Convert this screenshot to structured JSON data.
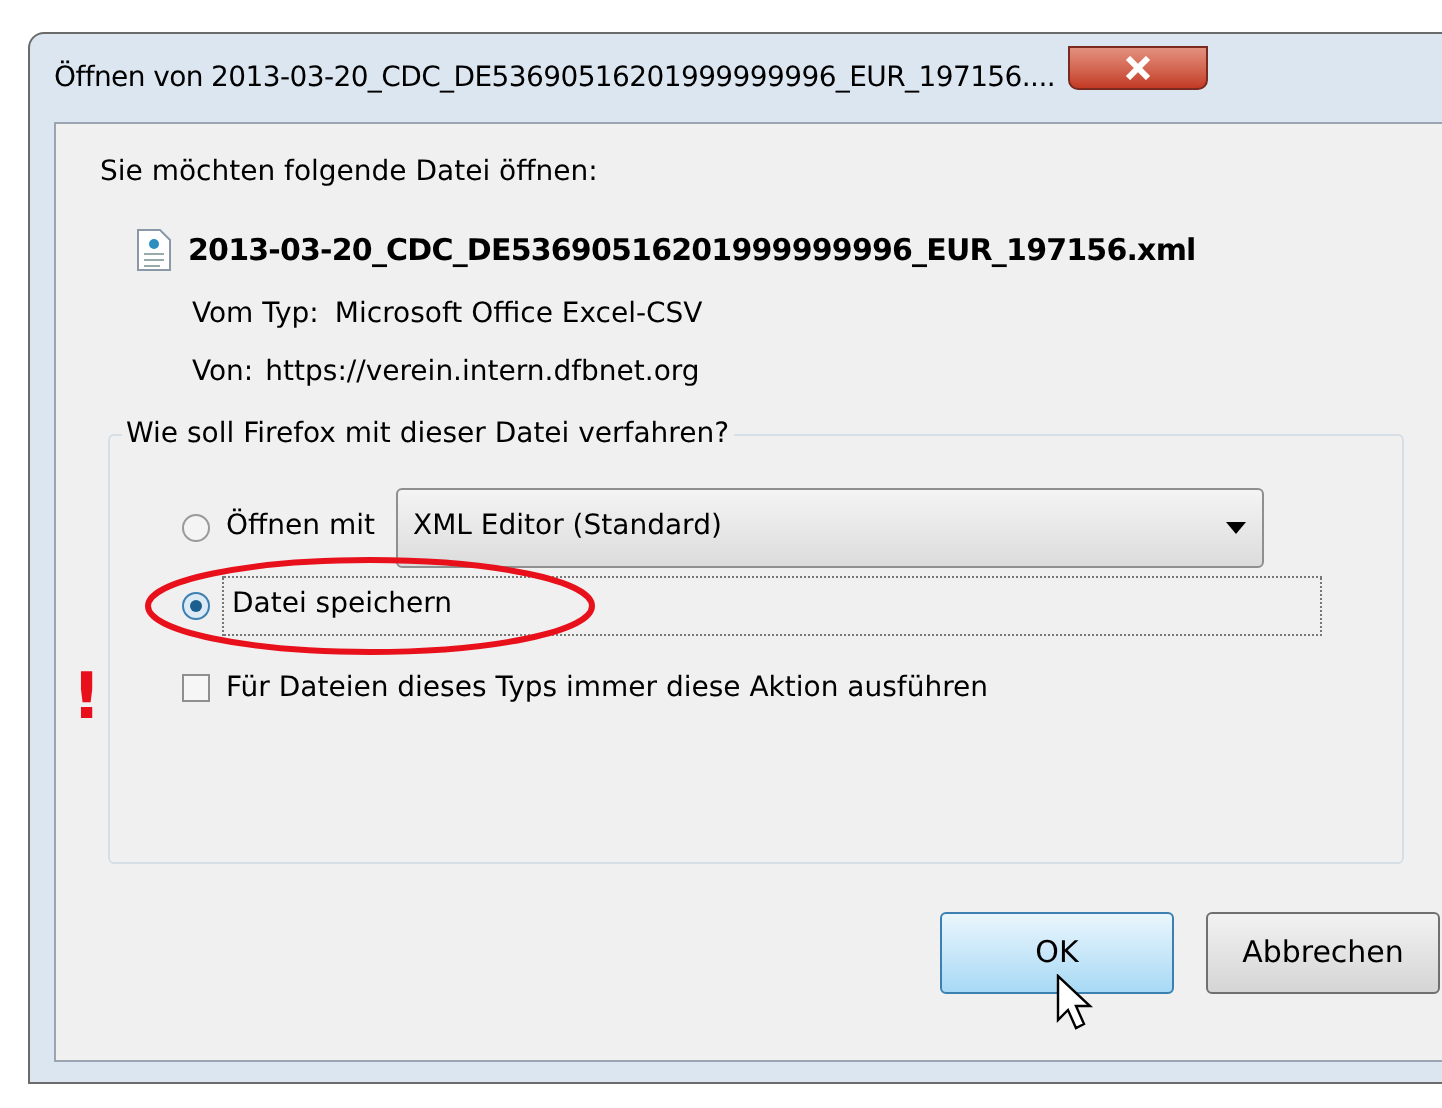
{
  "window": {
    "title": "Öffnen von 2013-03-20_CDC_DE53690516201999999996_EUR_197156...."
  },
  "intro": "Sie möchten folgende Datei öffnen:",
  "file": {
    "name": "2013-03-20_CDC_DE53690516201999999996_EUR_197156.xml",
    "type_label": "Vom Typ:",
    "type": "Microsoft Office Excel-CSV",
    "from_label": "Von:",
    "from": "https://verein.intern.dfbnet.org"
  },
  "group": {
    "title": "Wie soll Firefox mit dieser Datei verfahren?",
    "options": [
      {
        "label": "Öffnen mit",
        "selected": false,
        "app": "XML Editor (Standard)"
      },
      {
        "label": "Datei speichern",
        "selected": true
      }
    ],
    "remember": {
      "label": "Für Dateien dieses Typs immer diese Aktion ausführen",
      "checked": false
    }
  },
  "annotation": {
    "mark": "!"
  },
  "buttons": [
    {
      "label": "OK",
      "default": true
    },
    {
      "label": "Abbrechen",
      "default": false
    }
  ]
}
